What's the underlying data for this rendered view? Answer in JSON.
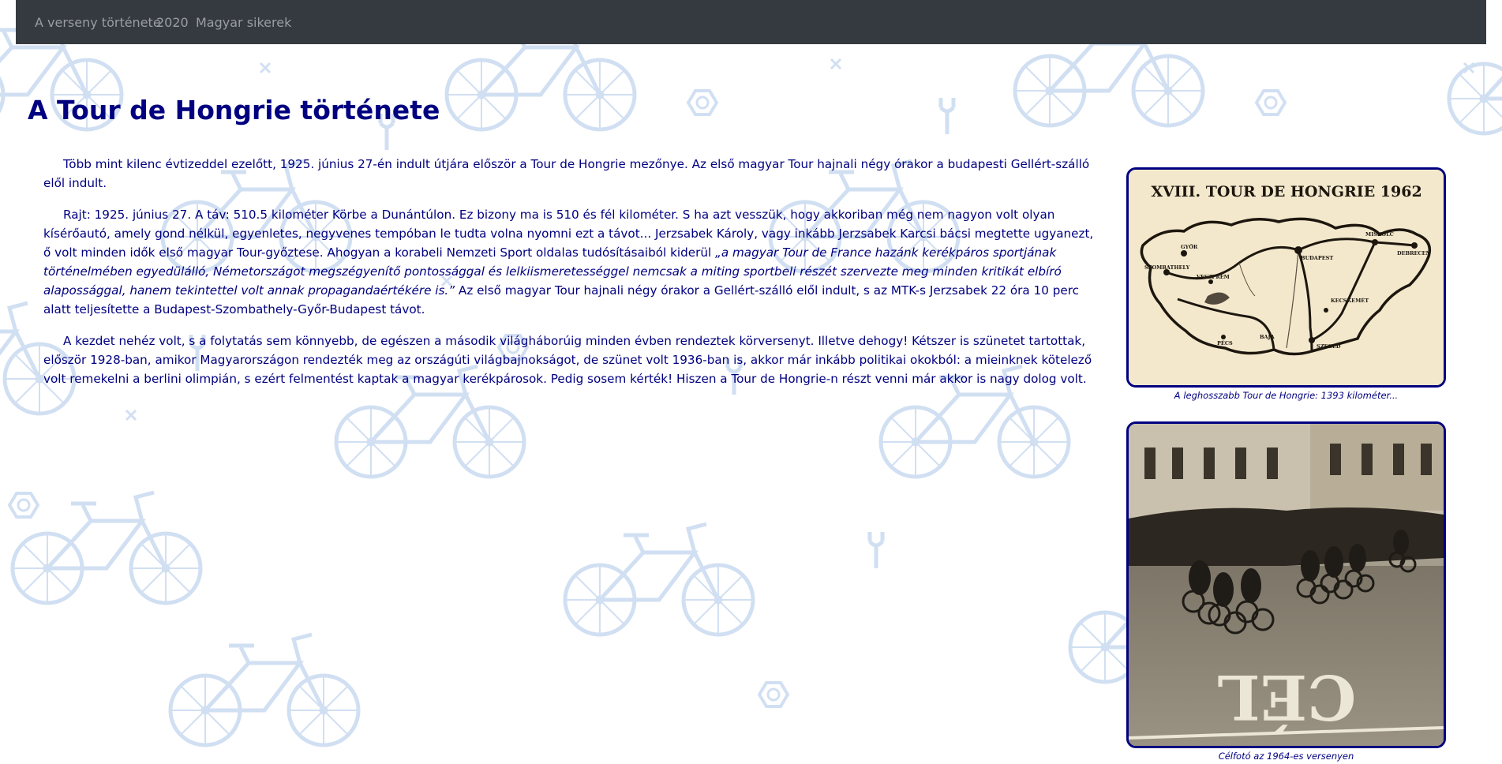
{
  "nav": {
    "items": [
      {
        "label": "A verseny története"
      },
      {
        "label": "2020"
      },
      {
        "label": "Magyar sikerek"
      }
    ]
  },
  "page": {
    "title": "A Tour de Hongrie története"
  },
  "article": {
    "p1": "Több mint kilenc évtizeddel ezelőtt, 1925. június 27-én indult útjára először a Tour de Hongrie mezőnye. Az első magyar Tour hajnali négy órakor a budapesti Gellért-szálló elől indult.",
    "p2_before": "Rajt: 1925. június 27. A táv: 510.5 kilométer Körbe a Dunántúlon. Ez bizony ma is 510 és fél kilométer. S ha azt vesszük, hogy akkoriban még nem nagyon volt olyan kísérőautó, amely gond nélkül, egyenletes, negyvenes tempóban le tudta volna nyomni ezt a távot... Jerzsabek Károly, vagy inkább Jerzsabek Karcsi bácsi megtette ugyanezt, ő volt minden idők első magyar Tour-győztese. Ahogyan a korabeli Nemzeti Sport oldalas tudósításaiból kiderül ",
    "p2_quote": "„a magyar Tour de France hazánk kerékpáros sportjának történelmében egyedülálló, Németországot megszégyenítő pontossággal és lelkiismeretességgel nemcsak a miting sportbeli részét szervezte meg minden kritikát elbíró alapossággal, hanem tekintettel volt annak propagandaértékére is.”",
    "p2_after": " Az első magyar Tour hajnali négy órakor a Gellért-szálló elől indult, s az MTK-s Jerzsabek 22 óra 10 perc alatt teljesítette a Budapest-Szombathely-Győr-Budapest távot.",
    "p3": "A kezdet nehéz volt, s a folytatás sem könnyebb, de egészen a második világháborúig minden évben rendeztek körversenyt. Illetve dehogy! Kétszer is szünetet tartottak, először 1928-ban, amikor Magyarországon rendezték meg az országúti világbajnokságot, de szünet volt 1936-ban is, akkor már inkább politikai okokból: a mieinknek kötelező volt remekelni a berlini olimpián, s ezért felmentést kaptak a magyar kerékpárosok. Pedig sosem kérték! Hiszen a Tour de Hongrie-n részt venni már akkor is nagy dolog volt."
  },
  "figures": {
    "map": {
      "heading": "XVIII. TOUR DE HONGRIE 1962",
      "caption": "A leghosszabb Tour de Hongrie: 1393 kilométer...",
      "cities": [
        "GYŐR",
        "BUDAPEST",
        "DEBRECEN",
        "SZEGED",
        "MISKOLC",
        "VESZPRÉM",
        "PÉCS",
        "SZOMBATHELY",
        "KECSKEMÉT",
        "BAJA"
      ]
    },
    "photo": {
      "caption": "Célfotó az 1964-es versenyen",
      "road_text": "CÉL"
    }
  },
  "colors": {
    "accent": "#000080",
    "navbar": "#343a40",
    "nav_text": "#9a9da1",
    "pattern": "#c5d7ef",
    "map_paper": "#f3e8cc",
    "photo_tone": "#8c8474"
  }
}
